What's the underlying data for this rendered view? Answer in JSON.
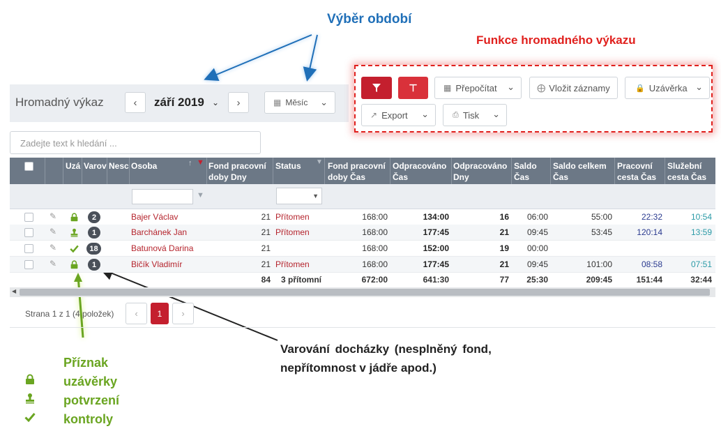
{
  "annotations": {
    "period_select": "Výběr období",
    "bulk_functions": "Funkce hromadného výkazu",
    "warning_line1": "Varování docházky (nesplněný fond,",
    "warning_line2": "nepřítomnost v jádře apod.)",
    "legend_title": "Příznak",
    "legend_items": [
      "uzávěrky",
      "potvrzení",
      "kontroly"
    ]
  },
  "header": {
    "title": "Hromadný výkaz",
    "period": "září 2019",
    "period_unit": "Měsíc"
  },
  "toolbar": {
    "recalc": "Přepočítat",
    "insert": "Vložit záznamy",
    "closing": "Uzávěrka",
    "export": "Export",
    "print": "Tisk"
  },
  "search": {
    "placeholder": "Zadejte text k hledání ..."
  },
  "columns": {
    "uza": "Uzá",
    "varov": "Varov",
    "nesc": "Nesc",
    "osoba": "Osoba",
    "fond_dny_1": "Fond pracovní",
    "fond_dny_2": "doby Dny",
    "status": "Status",
    "fond_cas_1": "Fond pracovní",
    "fond_cas_2": "doby Čas",
    "odpr_cas_1": "Odpracováno",
    "odpr_cas_2": "Čas",
    "odpr_dny_1": "Odpracováno",
    "odpr_dny_2": "Dny",
    "saldo_1": "Saldo",
    "saldo_2": "Čas",
    "saldo_celk_1": "Saldo celkem",
    "saldo_celk_2": "Čas",
    "prac_cesta_1": "Pracovní",
    "prac_cesta_2": "cesta Čas",
    "sluz_cesta_1": "Služební",
    "sluz_cesta_2": "cesta Čas"
  },
  "rows": [
    {
      "flag": "lock",
      "warn": "2",
      "osoba": "Bajer Václav",
      "fond_dny": "21",
      "status": "Přítomen",
      "fond_cas": "168:00",
      "odpr_cas": "134:00",
      "odpr_dny": "16",
      "saldo": "06:00",
      "saldo_celk": "55:00",
      "prac_cesta": "22:32",
      "sluz_cesta": "10:54"
    },
    {
      "flag": "stamp",
      "warn": "1",
      "osoba": "Barchánek Jan",
      "fond_dny": "21",
      "status": "Přítomen",
      "fond_cas": "168:00",
      "odpr_cas": "177:45",
      "odpr_dny": "21",
      "saldo": "09:45",
      "saldo_celk": "53:45",
      "prac_cesta": "120:14",
      "sluz_cesta": "13:59"
    },
    {
      "flag": "check",
      "warn": "18",
      "osoba": "Batunová Darina",
      "fond_dny": "21",
      "status": "",
      "fond_cas": "168:00",
      "odpr_cas": "152:00",
      "odpr_dny": "19",
      "saldo": "00:00",
      "saldo_celk": "",
      "prac_cesta": "",
      "sluz_cesta": ""
    },
    {
      "flag": "lock",
      "warn": "1",
      "osoba": "Bičík Vladimír",
      "fond_dny": "21",
      "status": "Přítomen",
      "fond_cas": "168:00",
      "odpr_cas": "177:45",
      "odpr_dny": "21",
      "saldo": "09:45",
      "saldo_celk": "101:00",
      "prac_cesta": "08:58",
      "sluz_cesta": "07:51"
    }
  ],
  "totals": {
    "fond_dny": "84",
    "status": "3 přítomní",
    "fond_cas": "672:00",
    "odpr_cas": "641:30",
    "odpr_dny": "77",
    "saldo": "25:30",
    "saldo_celk": "209:45",
    "prac_cesta": "151:44",
    "sluz_cesta": "32:44"
  },
  "pager": {
    "info": "Strana 1 z 1 (4 položek)",
    "current_page": "1"
  },
  "colors": {
    "accent_red": "#c41f2e",
    "header_gray": "#6c7886",
    "name_red": "#b5242d",
    "green": "#6aa521",
    "annotation_blue": "#1f6fb8"
  }
}
